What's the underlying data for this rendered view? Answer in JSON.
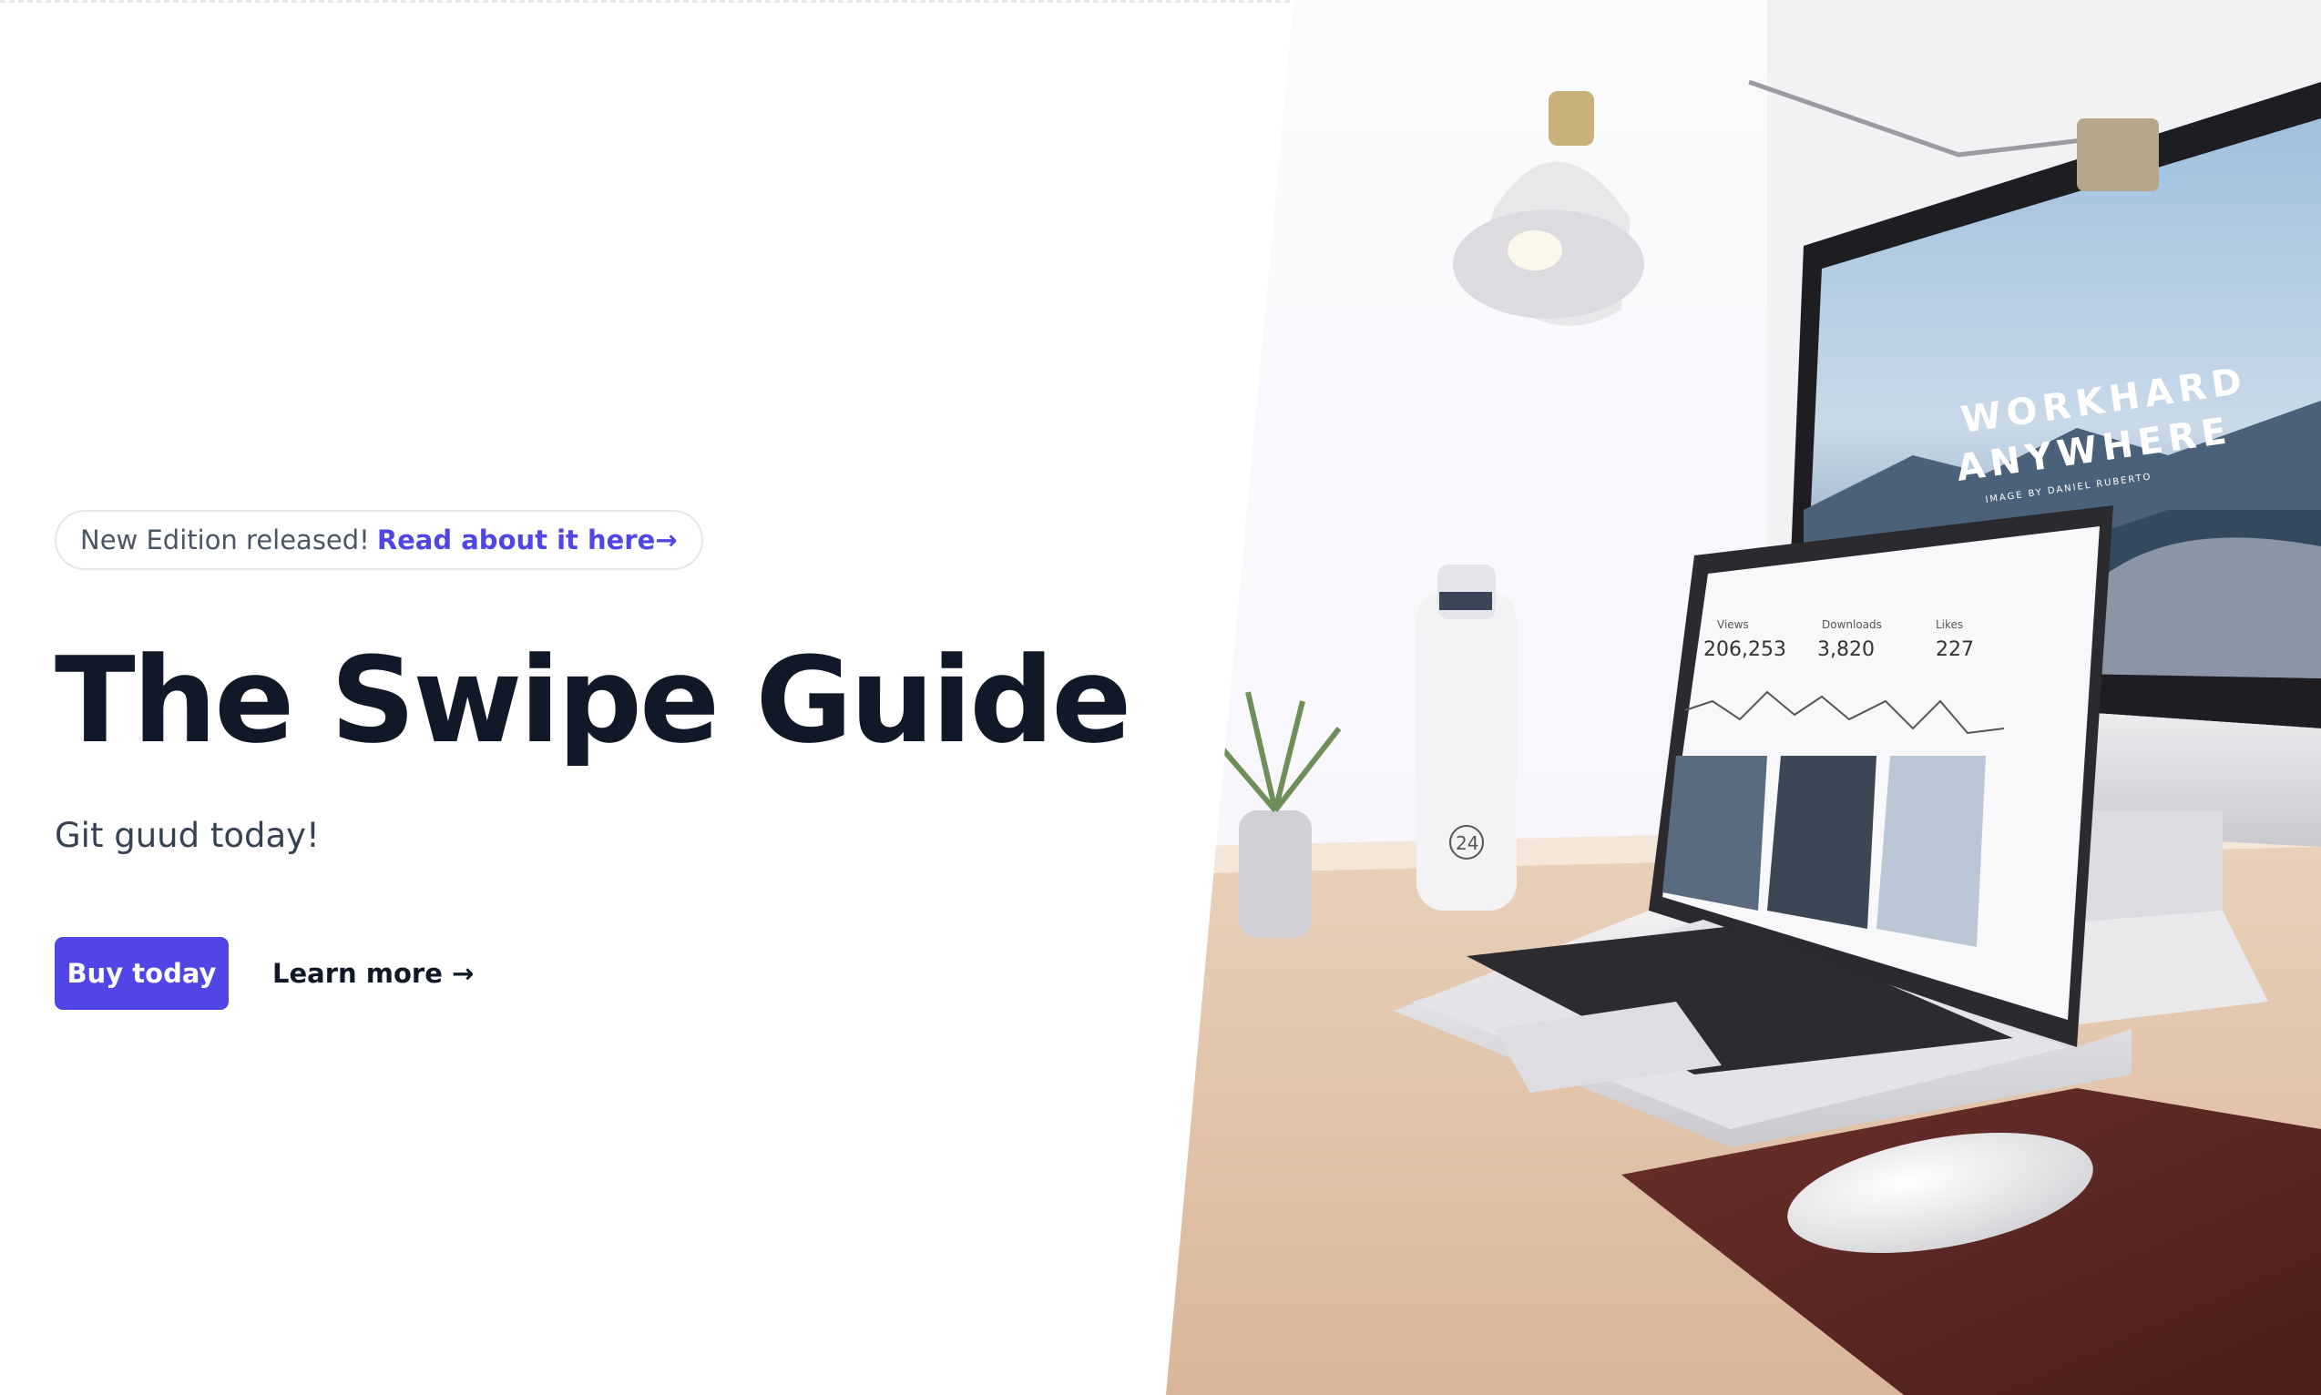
{
  "announcement": {
    "text": "New Edition released!",
    "link_label": "Read about it here→"
  },
  "hero": {
    "title": "The Swipe Guide",
    "subtitle": "Git guud today!",
    "primary_button": "Buy today",
    "secondary_link": "Learn more →"
  },
  "photo": {
    "monitor_headline_1": "WORKHARD",
    "monitor_headline_2": "ANYWHERE",
    "monitor_caption": "IMAGE BY DANIEL RUBERTO",
    "laptop_stats": [
      {
        "label": "Views",
        "value": "206,253"
      },
      {
        "label": "Downloads",
        "value": "3,820"
      },
      {
        "label": "Likes",
        "value": "227"
      }
    ],
    "bottle_number": "24"
  },
  "colors": {
    "accent": "#4f46e5",
    "title": "#111827",
    "muted": "#4b5563"
  }
}
